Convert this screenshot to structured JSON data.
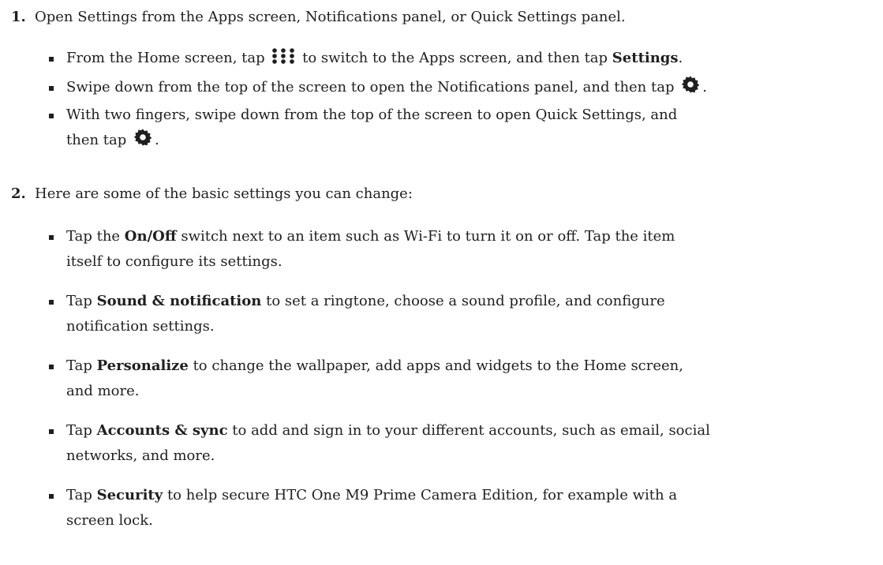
{
  "steps": [
    {
      "number": "1.",
      "text": "Open Settings from the Apps screen, Notifications panel, or Quick Settings panel.",
      "bullets": [
        {
          "pre": "From the Home screen, tap",
          "icon": "apps-grid-icon",
          "mid": "to switch to the Apps screen, and then tap",
          "bold": "Settings",
          "post": "."
        },
        {
          "pre": "Swipe down from the top of the screen to open the Notifications panel, and then tap",
          "icon": "gear-icon",
          "post": "."
        },
        {
          "pre_line1": "With two fingers, swipe down from the top of the screen to open Quick Settings, and",
          "pre_line2": "then tap",
          "icon": "gear-icon",
          "post": "."
        }
      ]
    },
    {
      "number": "2.",
      "text": "Here are some of the basic settings you can change:",
      "bullets": [
        {
          "pre": "Tap the",
          "bold": "On/Off",
          "line1": "switch next to an item such as Wi-Fi to turn it on or off. Tap the item",
          "line2": "itself to configure its settings."
        },
        {
          "pre": "Tap",
          "bold": "Sound & notification",
          "line1": "to set a ringtone, choose a sound profile, and configure",
          "line2": "notification settings."
        },
        {
          "pre": "Tap",
          "bold": "Personalize",
          "line1": "to change the wallpaper, add apps and widgets to the Home screen,",
          "line2": "and more."
        },
        {
          "pre": "Tap",
          "bold": "Accounts & sync",
          "line1": "to add and sign in to your different accounts, such as email, social",
          "line2": "networks, and more."
        },
        {
          "pre": "Tap",
          "bold": "Security",
          "line1": "to help secure HTC One M9 Prime Camera Edition, for example with a",
          "line2": "screen lock."
        }
      ]
    }
  ]
}
